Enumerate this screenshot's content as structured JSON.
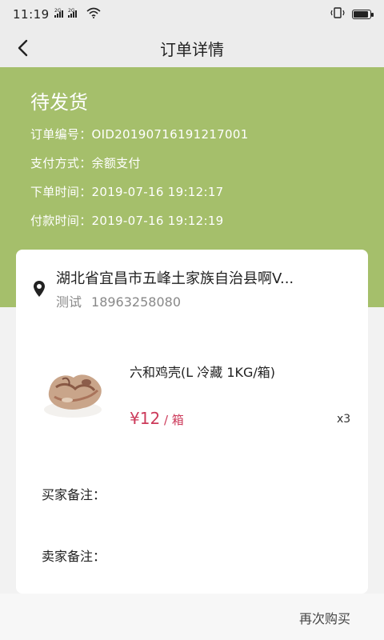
{
  "status_bar": {
    "time": "11:19",
    "network_1": "2G",
    "network_2": "2G"
  },
  "nav": {
    "title": "订单详情"
  },
  "order": {
    "status": "待发货",
    "number_label": "订单编号：",
    "number_value": "OID20190716191217001",
    "pay_method_label": "支付方式：",
    "pay_method_value": "余额支付",
    "order_time_label": "下单时间：",
    "order_time_value": "2019-07-16 19:12:17",
    "pay_time_label": "付款时间：",
    "pay_time_value": "2019-07-16 19:12:19"
  },
  "address": {
    "text": "湖北省宜昌市五峰土家族自治县啊V...",
    "name": "测试",
    "phone": "18963258080"
  },
  "product": {
    "name": "六和鸡壳(L 冷藏 1KG/箱)",
    "price": "¥12",
    "unit": " / 箱",
    "quantity": "x3"
  },
  "remarks": {
    "buyer_label": "买家备注：",
    "seller_label": "卖家备注："
  },
  "actions": {
    "rebuy_label": "再次购买"
  },
  "colors": {
    "header_green": "#a5bf6b",
    "price_red": "#cc3a5a"
  }
}
